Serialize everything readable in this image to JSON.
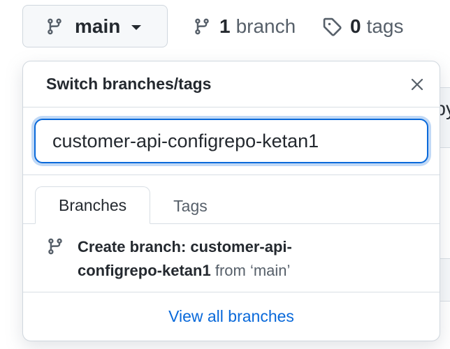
{
  "repo_bar": {
    "current_branch": "main",
    "branch_count": "1",
    "branch_label": "branch",
    "tag_count": "0",
    "tag_label": "tags"
  },
  "dropdown": {
    "title": "Switch branches/tags",
    "filter_value": "customer-api-configrepo-ketan1",
    "tabs": [
      {
        "label": "Branches",
        "active": true
      },
      {
        "label": "Tags",
        "active": false
      }
    ],
    "create_branch": {
      "prefix": "Create branch: customer-api-configrepo-ketan1",
      "from_text": "from ‘main’"
    },
    "view_all_label": "View all branches"
  },
  "background": {
    "partial_text": "py"
  },
  "icons": {
    "branch": "git-branch-icon",
    "tag": "tag-icon",
    "close": "close-icon",
    "caret": "caret-down-icon"
  },
  "colors": {
    "accent": "#0969da",
    "text": "#24292f",
    "muted": "#57606a",
    "border": "#d0d7de"
  }
}
